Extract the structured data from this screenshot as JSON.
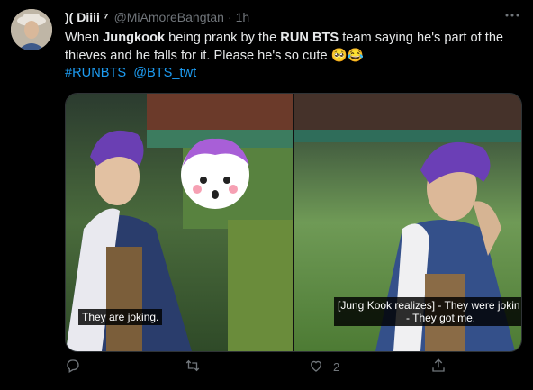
{
  "tweet": {
    "display_name": ")( Diiii ⁷",
    "handle": "@MiAmoreBangtan",
    "separator": "·",
    "time": "1h",
    "text_parts": [
      {
        "t": "When ",
        "b": false
      },
      {
        "t": "Jungkook",
        "b": true
      },
      {
        "t": " being prank by the ",
        "b": false
      },
      {
        "t": "RUN BTS",
        "b": true
      },
      {
        "t": " team  saying he's part of the thieves and he falls for it. Please he's so cute ",
        "b": false
      }
    ],
    "emoji": "🥺😂",
    "hashtag": "#RUNBTS",
    "mention": "@BTS_twt"
  },
  "media": {
    "left_caption": "They are joking.",
    "right_caption_line1": "[Jung Kook realizes] - They were jokin",
    "right_caption_line2": "- They got me."
  },
  "actions": {
    "reply_count": "",
    "retweet_count": "",
    "like_count": "2",
    "share_count": ""
  },
  "icons": [
    "avatar",
    "more-icon",
    "reply-icon",
    "retweet-icon",
    "like-icon",
    "share-icon"
  ],
  "colors": {
    "link": "#1d9bf0",
    "muted": "#71767b",
    "text": "#e7e9ea",
    "bg": "#000000"
  }
}
